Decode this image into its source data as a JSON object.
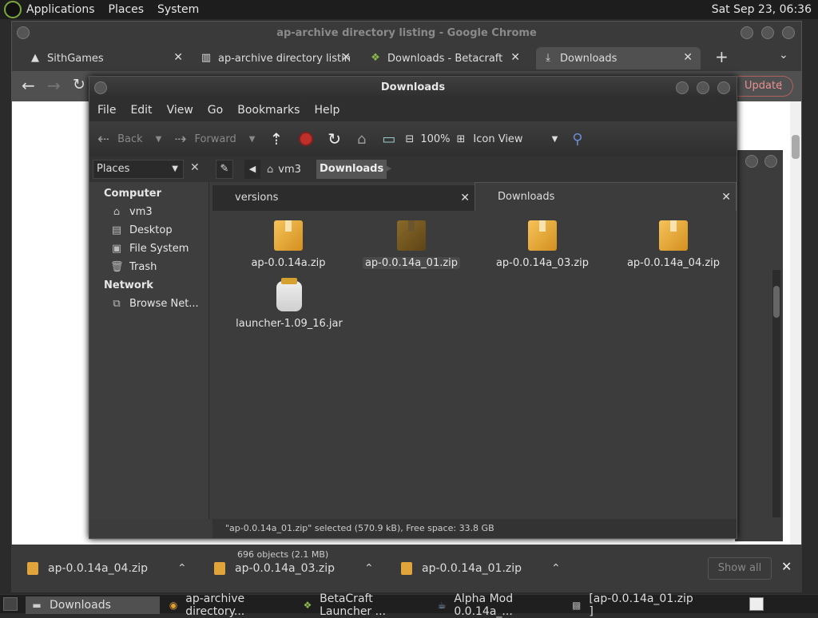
{
  "topbar": {
    "menus": [
      "Applications",
      "Places",
      "System"
    ],
    "clock": "Sat Sep 23, 06:36"
  },
  "chrome": {
    "title": "ap-archive directory listing - Google Chrome",
    "tabs": [
      {
        "label": "SithGames"
      },
      {
        "label": "ap-archive directory listin"
      },
      {
        "label": "Downloads - Betacraft"
      },
      {
        "label": "Downloads"
      }
    ],
    "new_tab": "+",
    "update_label": "Update",
    "downloads": [
      {
        "label": "ap-0.0.14a_04.zip"
      },
      {
        "label": "ap-0.0.14a_03.zip"
      },
      {
        "label": "ap-0.0.14a_01.zip"
      }
    ],
    "show_all": "Show all"
  },
  "nautilus": {
    "title": "Downloads",
    "menu": [
      "File",
      "Edit",
      "View",
      "Go",
      "Bookmarks",
      "Help"
    ],
    "toolbar": {
      "back": "Back",
      "forward": "Forward",
      "zoom": "100%",
      "view_mode": "Icon View"
    },
    "breadcrumb": [
      "vm3",
      "Downloads"
    ],
    "places_label": "Places",
    "sidebar": {
      "computer_heading": "Computer",
      "computer_items": [
        "vm3",
        "Desktop",
        "File System",
        "Trash"
      ],
      "network_heading": "Network",
      "network_items": [
        "Browse Net..."
      ]
    },
    "tabs": [
      "versions",
      "Downloads"
    ],
    "files": [
      {
        "name": "ap-0.0.14a.zip"
      },
      {
        "name": "ap-0.0.14a_01.zip"
      },
      {
        "name": "ap-0.0.14a_03.zip"
      },
      {
        "name": "ap-0.0.14a_04.zip"
      },
      {
        "name": "launcher-1.09_16.jar"
      }
    ],
    "status": "\"ap-0.0.14a_01.zip\" selected (570.9 kB), Free space: 33.8 GB",
    "object_count": "696 objects (2.1 MB)"
  },
  "taskbar": {
    "items": [
      {
        "label": "Downloads"
      },
      {
        "label": "ap-archive directory..."
      },
      {
        "label": "BetaCraft Launcher ..."
      },
      {
        "label": "Alpha Mod 0.0.14a_..."
      },
      {
        "label": "[ap-0.0.14a_01.zip ]"
      }
    ]
  }
}
